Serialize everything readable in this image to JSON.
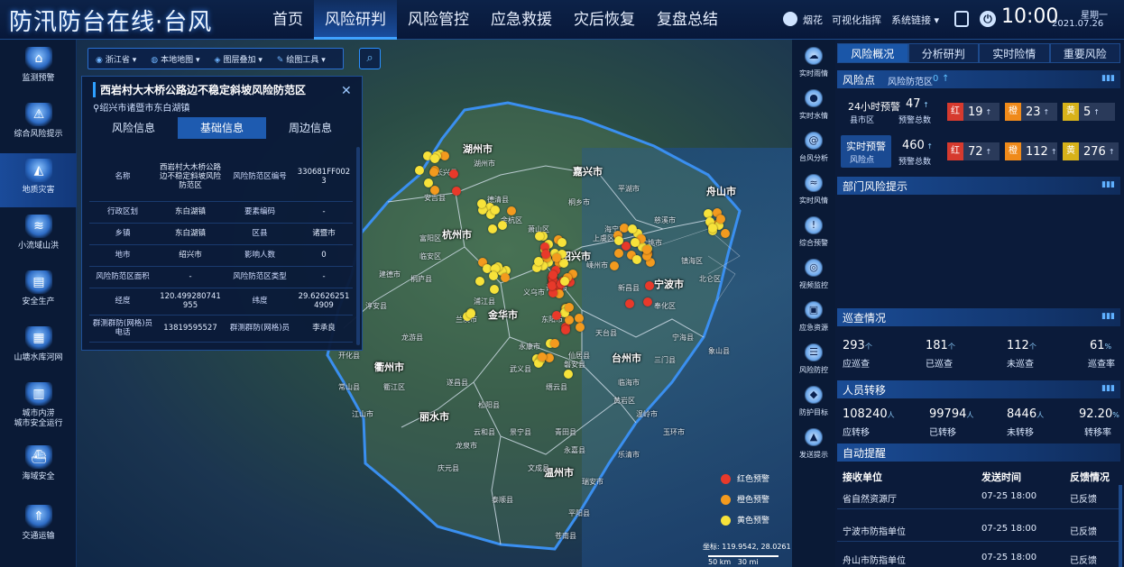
{
  "app": {
    "title": "防汛防台在线·台风"
  },
  "nav": {
    "tabs": [
      "首页",
      "风险研判",
      "风险管控",
      "应急救援",
      "灾后恢复",
      "复盘总结"
    ],
    "active": 1
  },
  "header_right": {
    "typhoon_name": "烟花",
    "visual_command": "可视化指挥",
    "system_link": "系统链接",
    "time": "10:00",
    "weekday": "星期一",
    "date": "2021.07.26"
  },
  "sidebar": {
    "items": [
      {
        "label": "监测预警",
        "icon": "monitor-warning-icon"
      },
      {
        "label": "综合风险提示",
        "icon": "warning-triangle-icon"
      },
      {
        "label": "地质灾害",
        "icon": "geology-disaster-icon"
      },
      {
        "label": "小流域山洪",
        "icon": "flash-flood-icon"
      },
      {
        "label": "安全生产",
        "icon": "factory-icon"
      },
      {
        "label": "山塘水库河网",
        "icon": "reservoir-icon"
      },
      {
        "label": "城市内涝\n城市安全运行",
        "icon": "city-icon"
      },
      {
        "label": "海域安全",
        "icon": "ship-icon"
      },
      {
        "label": "交通运输",
        "icon": "road-icon"
      }
    ],
    "active": 2
  },
  "map": {
    "toolbar": [
      {
        "label": "浙江省",
        "icon": "location-pin-icon"
      },
      {
        "label": "本地地图",
        "icon": "globe-icon"
      },
      {
        "label": "图层叠加",
        "icon": "layers-icon"
      },
      {
        "label": "绘图工具",
        "icon": "pen-icon"
      }
    ],
    "cities": [
      "湖州市",
      "嘉兴市",
      "舟山市",
      "杭州市",
      "绍兴市",
      "宁波市",
      "金华市",
      "台州市",
      "丽水市",
      "温州市",
      "衢州市"
    ],
    "towns": [
      "长兴县",
      "安吉县",
      "德清县",
      "湖州市",
      "海宁市",
      "平湖市",
      "桐乡市",
      "余杭区",
      "富阳区",
      "临安区",
      "萧山区",
      "桐庐县",
      "淳安县",
      "建德市",
      "诸暨市",
      "上虞区",
      "余姚市",
      "慈溪市",
      "镇海区",
      "北仑区",
      "奉化区",
      "宁海县",
      "象山县",
      "嵊州市",
      "新昌县",
      "天台县",
      "三门县",
      "临海市",
      "温岭市",
      "玉环市",
      "黄岩区",
      "仙居县",
      "永康市",
      "东阳市",
      "义乌市",
      "浦江县",
      "兰溪市",
      "武义县",
      "磐安县",
      "缙云县",
      "遂昌县",
      "松阳县",
      "云和县",
      "庆元县",
      "龙泉市",
      "景宁县",
      "青田县",
      "文成县",
      "泰顺县",
      "瑞安市",
      "平阳县",
      "苍南县",
      "永嘉县",
      "乐清市",
      "江山市",
      "常山县",
      "开化县",
      "龙游县",
      "衢江区"
    ],
    "legend": [
      {
        "label": "红色预警",
        "color": "#e8392a"
      },
      {
        "label": "橙色预警",
        "color": "#f39a1e"
      },
      {
        "label": "黄色预警",
        "color": "#f7e23a"
      }
    ],
    "coords_label": "坐标:",
    "coords_value": "119.9542, 28.0261",
    "scale_km": "50 km",
    "scale_mi": "30 mi"
  },
  "popup": {
    "title": "西岩村大木桥公路边不稳定斜坡风险防范区",
    "location": "绍兴市诸暨市东白湖镇",
    "tabs": [
      "风险信息",
      "基础信息",
      "周边信息"
    ],
    "active_tab": 1,
    "rows": [
      [
        "名称",
        "西岩村大木桥公路边不稳定斜坡风险防范区",
        "风险防范区编号",
        "330681FF0023"
      ],
      [
        "行政区划",
        "东白湖镇",
        "要素编码",
        "-"
      ],
      [
        "乡镇",
        "东白湖镇",
        "区县",
        "诸暨市"
      ],
      [
        "地市",
        "绍兴市",
        "影响人数",
        "0"
      ],
      [
        "风险防范区面积",
        "-",
        "风险防范区类型",
        "-"
      ],
      [
        "经度",
        "120.499280741955",
        "纬度",
        "29.626262514909"
      ],
      [
        "群测群防(网格)员电话",
        "13819595527",
        "群测群防(网格)员",
        "李承良"
      ]
    ]
  },
  "right_icons": [
    {
      "label": "实时雨情",
      "icon": "cloud-rain-icon"
    },
    {
      "label": "实时水情",
      "icon": "water-drop-icon"
    },
    {
      "label": "台风分析",
      "icon": "typhoon-icon"
    },
    {
      "label": "实时风情",
      "icon": "wind-icon"
    },
    {
      "label": "综合预警",
      "icon": "alarm-icon"
    },
    {
      "label": "视频监控",
      "icon": "camera-icon"
    },
    {
      "label": "应急资源",
      "icon": "box-icon"
    },
    {
      "label": "风险防控",
      "icon": "shield-list-icon"
    },
    {
      "label": "防护目标",
      "icon": "shield-icon"
    },
    {
      "label": "发送提示",
      "icon": "siren-icon"
    }
  ],
  "panel": {
    "tabs": [
      "风险概况",
      "分析研判",
      "实时险情",
      "重要风险"
    ],
    "active_tab": 0,
    "risk_points": {
      "title": "风险点",
      "sub_label": "风险防范区",
      "sub_value": "0",
      "forecast_24h": {
        "label": "24小时预警",
        "sub": "县市区",
        "value": "47",
        "total_label": "预警总数"
      },
      "forecast_24h_badges": [
        {
          "key": "红",
          "value": "19",
          "color": "#d63a2e"
        },
        {
          "key": "橙",
          "value": "23",
          "color": "#ef8a1a"
        },
        {
          "key": "黄",
          "value": "5",
          "color": "#d7b21a"
        }
      ],
      "realtime": {
        "label": "实时预警",
        "sub": "风险点",
        "value": "460",
        "total_label": "预警总数"
      },
      "realtime_badges": [
        {
          "key": "红",
          "value": "72",
          "color": "#d63a2e"
        },
        {
          "key": "橙",
          "value": "112",
          "color": "#ef8a1a"
        },
        {
          "key": "黄",
          "value": "276",
          "color": "#d7b21a"
        }
      ]
    },
    "dept_alert": {
      "title": "部门风险提示"
    },
    "patrol": {
      "title": "巡查情况",
      "stats": [
        {
          "value": "293",
          "unit": "个",
          "label": "应巡查"
        },
        {
          "value": "181",
          "unit": "个",
          "label": "已巡查"
        },
        {
          "value": "112",
          "unit": "个",
          "label": "未巡查"
        },
        {
          "value": "61",
          "unit": "%",
          "label": "巡查率"
        }
      ]
    },
    "transfer": {
      "title": "人员转移",
      "stats": [
        {
          "value": "108240",
          "unit": "人",
          "label": "应转移"
        },
        {
          "value": "99794",
          "unit": "人",
          "label": "已转移"
        },
        {
          "value": "8446",
          "unit": "人",
          "label": "未转移"
        },
        {
          "value": "92.20",
          "unit": "%",
          "label": "转移率"
        }
      ]
    },
    "auto_remind": {
      "title": "自动提醒",
      "headers": [
        "接收单位",
        "发送时间",
        "反馈情况"
      ],
      "rows": [
        [
          "省自然资源厅",
          "07-25 18:00",
          "已反馈"
        ],
        [
          "宁波市防指单位",
          "07-25 18:00",
          "已反馈"
        ],
        [
          "舟山市防指单位",
          "07-25 18:00",
          "已反馈"
        ]
      ]
    }
  }
}
